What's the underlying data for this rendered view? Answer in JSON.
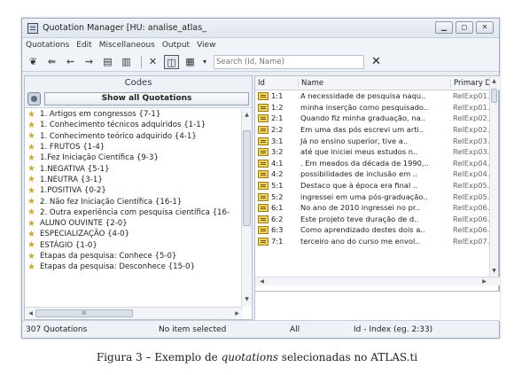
{
  "window": {
    "title": "Quotation Manager [HU: analise_atlas_",
    "controls": [
      "▁",
      "◻",
      "✕"
    ]
  },
  "menu": [
    "Quotations",
    "Edit",
    "Miscellaneous",
    "Output",
    "View"
  ],
  "toolbar": {
    "search_placeholder": "Search (Id, Name)",
    "clear_icon": "✕"
  },
  "codes": {
    "header": "Codes",
    "show_all_label": "Show all Quotations",
    "items": [
      "1. Artigos em congressos {7-1}",
      "1. Conhecimento técnicos adquiridos {1-1}",
      "1. Conhecimento teórico adquirido {4-1}",
      "1. FRUTOS {1-4}",
      "1.Fez Iniciação Científica {9-3}",
      "1.NEGATIVA {5-1}",
      "1.NEUTRA {3-1}",
      "1.POSITIVA {0-2}",
      "2. Não fez Iniciação Científica {16-1}",
      "2. Outra experiência com pesquisa científica {16-",
      "ALUNO OUVINTE {2-0}",
      "ESPECIALIZAÇÃO {4-0}",
      "ESTÁGIO {1-0}",
      "Etapas da pesquisa: Conhece {5-0}",
      "Etapas da pesquisa: Desconhece {15-0}"
    ],
    "hscroll_grip": "III"
  },
  "quotations": {
    "columns": [
      "Id",
      "Name",
      "Primary Dc"
    ],
    "rows": [
      {
        "id": "1:1",
        "name": "A necessidade de pesquisa naqu..",
        "doc": "RelExp01.."
      },
      {
        "id": "1:2",
        "name": "minha inserção como pesquisado..",
        "doc": "RelExp01.."
      },
      {
        "id": "2:1",
        "name": "Quando fiz minha graduação, na..",
        "doc": "RelExp02.."
      },
      {
        "id": "2:2",
        "name": "Em uma das pós escrevi um arti..",
        "doc": "RelExp02.."
      },
      {
        "id": "3:1",
        "name": "Já no ensino superior, tive a..",
        "doc": "RelExp03.."
      },
      {
        "id": "3:2",
        "name": "até que iniciei meus estudos n..",
        "doc": "RelExp03.."
      },
      {
        "id": "4:1",
        "name": ". Em meados da década de 1990,..",
        "doc": "RelExp04.."
      },
      {
        "id": "4:2",
        "name": "possibilidades de inclusão em ..",
        "doc": "RelExp04.."
      },
      {
        "id": "5:1",
        "name": "Destaco que à época era final ..",
        "doc": "RelExp05.."
      },
      {
        "id": "5:2",
        "name": "ingressei em uma pós-graduação..",
        "doc": "RelExp05.."
      },
      {
        "id": "6:1",
        "name": "No ano de 2010 ingressei no pr..",
        "doc": "RelExp06.."
      },
      {
        "id": "6:2",
        "name": "Este projeto teve duração de d..",
        "doc": "RelExp06.."
      },
      {
        "id": "6:3",
        "name": "Como aprendizado destes dois a..",
        "doc": "RelExp06.."
      },
      {
        "id": "7:1",
        "name": "terceiro ano do curso me envol..",
        "doc": "RelExp07.."
      }
    ]
  },
  "status": {
    "count": "307 Quotations",
    "selection": "No item selected",
    "filter": "All",
    "sort": "Id - Index (eg. 2:33)"
  },
  "caption": {
    "prefix": "Figura 3 – Exemplo de ",
    "emphasis": "quotations",
    "suffix": " selecionadas no ATLAS.ti"
  }
}
